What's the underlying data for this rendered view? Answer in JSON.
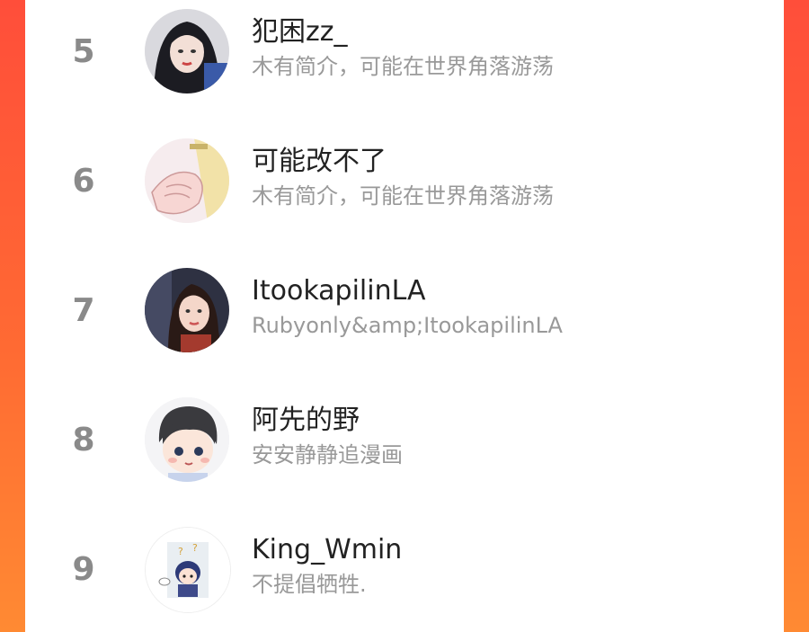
{
  "colors": {
    "background_accent": "#ff5a3a",
    "rank": "#8a8a8a",
    "name": "#222222",
    "bio": "#999999"
  },
  "list": [
    {
      "rank": "5",
      "name": "犯困zz_",
      "bio": "木有简介，可能在世界角落游荡",
      "avatar_icon": "avatar-girl-dark-hair"
    },
    {
      "rank": "6",
      "name": "可能改不了",
      "bio": "木有简介，可能在世界角落游荡",
      "avatar_icon": "avatar-anime-hands"
    },
    {
      "rank": "7",
      "name": "ItookapilinLA",
      "bio": "Rubyonly&amp;ItookapilinLA",
      "avatar_icon": "avatar-girl-photo"
    },
    {
      "rank": "8",
      "name": "阿先的野",
      "bio": "安安静静追漫画",
      "avatar_icon": "avatar-chibi-boy"
    },
    {
      "rank": "9",
      "name": "King_Wmin",
      "bio": "不提倡牺牲.",
      "avatar_icon": "avatar-chibi-question"
    }
  ]
}
